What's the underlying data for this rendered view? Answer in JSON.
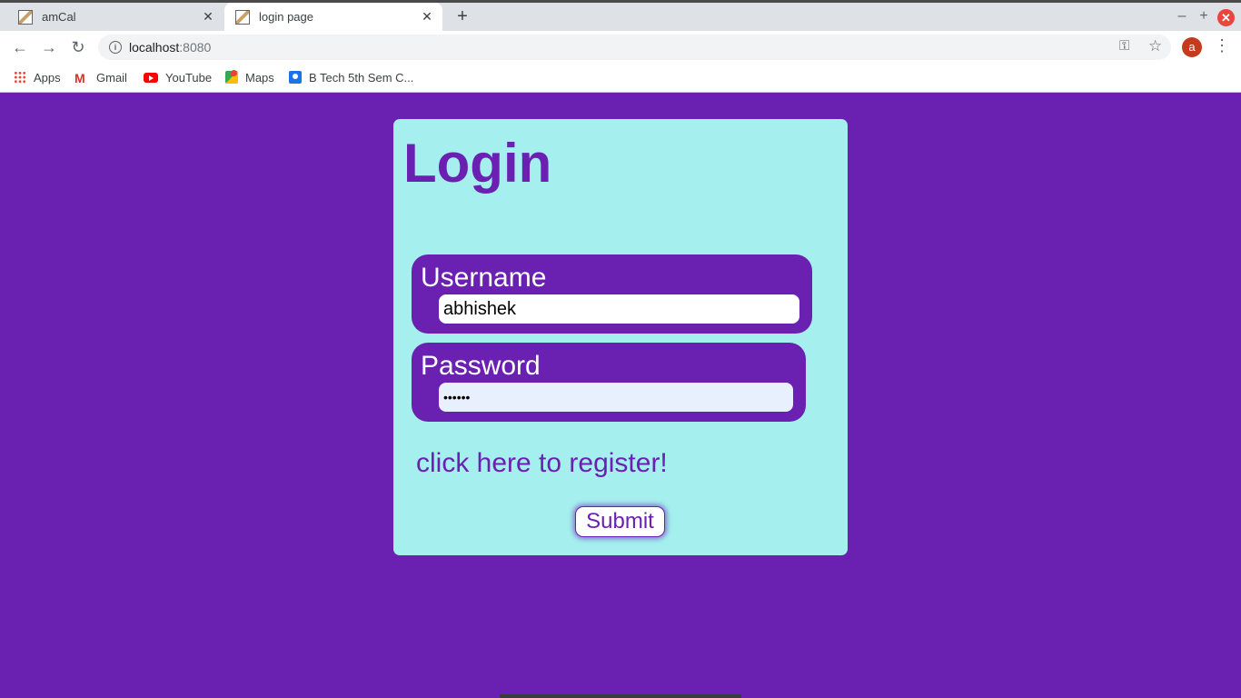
{
  "browser": {
    "tabs": [
      {
        "title": "amCal",
        "active": false
      },
      {
        "title": "login page",
        "active": true
      }
    ],
    "url_host": "localhost",
    "url_port": ":8080",
    "avatar_letter": "a",
    "bookmarks": [
      {
        "label": "Apps",
        "icon": "apps-grid-icon"
      },
      {
        "label": "Gmail",
        "icon": "gmail-icon"
      },
      {
        "label": "YouTube",
        "icon": "youtube-icon"
      },
      {
        "label": "Maps",
        "icon": "maps-icon"
      },
      {
        "label": "B Tech 5th Sem C...",
        "icon": "classroom-icon"
      }
    ]
  },
  "login": {
    "title": "Login",
    "username_label": "Username",
    "username_value": "abhishek",
    "password_label": "Password",
    "password_value": "••••••",
    "register_link": "click here to register!",
    "submit_label": "Submit"
  },
  "colors": {
    "background": "#6a21b2",
    "card": "#a5f0ef",
    "accent": "#6a21b2"
  }
}
